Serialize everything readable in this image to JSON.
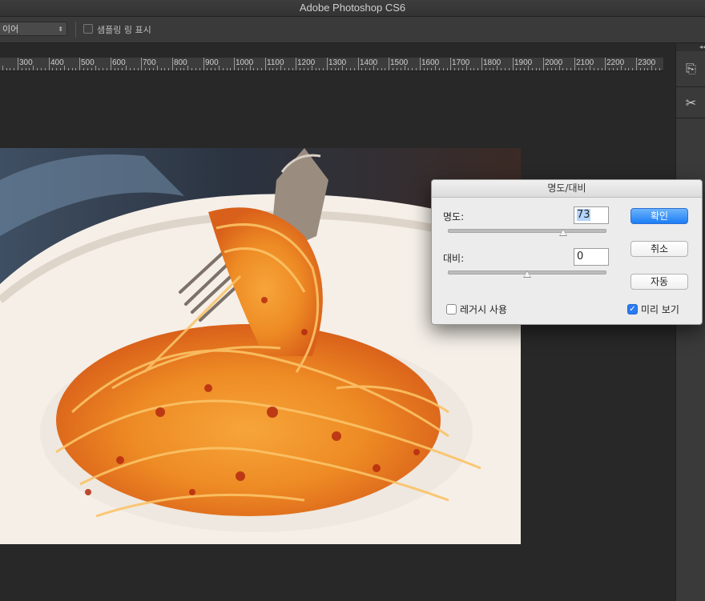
{
  "app": {
    "title": "Adobe Photoshop CS6"
  },
  "options_bar": {
    "select_value": "이어",
    "show_sampling_ring_label": "샘플링 링 표시",
    "show_sampling_ring_checked": false
  },
  "ruler": {
    "labels": [
      "300",
      "400",
      "500",
      "600",
      "700",
      "800",
      "900",
      "1000",
      "1100",
      "1200",
      "1300",
      "1400",
      "1500",
      "1600",
      "1700",
      "1800",
      "1900",
      "2000",
      "2100",
      "2200",
      "2300"
    ]
  },
  "right_panel": {
    "tools": [
      "clone-stamp-icon",
      "tools-icon"
    ]
  },
  "dialog": {
    "title": "명도/대비",
    "brightness_label": "명도:",
    "brightness_value": "73",
    "brightness_slider": 0.73,
    "contrast_label": "대비:",
    "contrast_value": "0",
    "contrast_slider": 0.5,
    "ok_label": "확인",
    "cancel_label": "취소",
    "auto_label": "자동",
    "legacy_label": "레거시 사용",
    "legacy_checked": false,
    "preview_label": "미리 보기",
    "preview_checked": true,
    "accent": "#1e7ef6"
  }
}
